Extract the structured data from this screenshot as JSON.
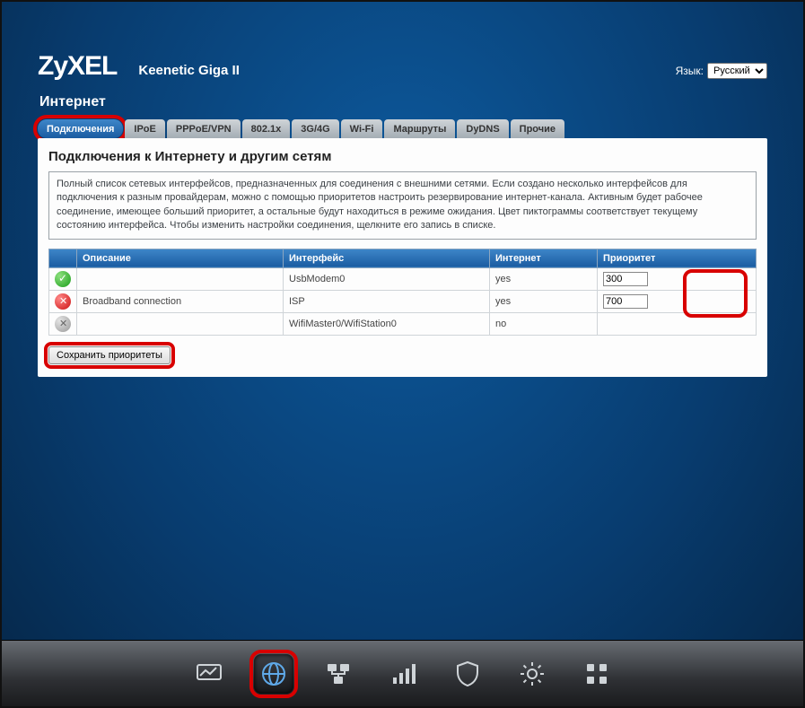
{
  "header": {
    "logo": "ZyXEL",
    "model": "Keenetic Giga II",
    "lang_label": "Язык:",
    "lang_value": "Русский"
  },
  "page_title": "Интернет",
  "tabs": [
    {
      "label": "Подключения",
      "active": true
    },
    {
      "label": "IPoE"
    },
    {
      "label": "PPPoE/VPN"
    },
    {
      "label": "802.1x"
    },
    {
      "label": "3G/4G"
    },
    {
      "label": "Wi-Fi"
    },
    {
      "label": "Маршруты"
    },
    {
      "label": "DyDNS"
    },
    {
      "label": "Прочие"
    }
  ],
  "content": {
    "heading": "Подключения к Интернету и другим сетям",
    "description": "Полный список сетевых интерфейсов, предназначенных для соединения с внешними сетями. Если создано несколько интерфейсов для подключения к разным провайдерам, можно с помощью приоритетов настроить резервирование интернет-канала. Активным будет рабочее соединение, имеющее больший приоритет, а остальные будут находиться в режиме ожидания. Цвет пиктограммы соответствует текущему состоянию интерфейса. Чтобы изменить настройки соединения, щелкните его запись в списке.",
    "columns": {
      "status": "",
      "desc": "Описание",
      "iface": "Интерфейс",
      "inet": "Интернет",
      "prio": "Приоритет"
    },
    "rows": [
      {
        "status": "ok",
        "desc": "",
        "iface": "UsbModem0",
        "inet": "yes",
        "prio": "300"
      },
      {
        "status": "err",
        "desc": "Broadband connection",
        "iface": "ISP",
        "inet": "yes",
        "prio": "700"
      },
      {
        "status": "off",
        "desc": "",
        "iface": "WifiMaster0/WifiStation0",
        "inet": "no",
        "prio": ""
      }
    ],
    "save_label": "Сохранить приоритеты"
  },
  "bottomnav": [
    {
      "name": "monitor-icon"
    },
    {
      "name": "globe-icon",
      "active": true
    },
    {
      "name": "network-icon"
    },
    {
      "name": "signal-icon"
    },
    {
      "name": "shield-icon"
    },
    {
      "name": "gear-icon"
    },
    {
      "name": "apps-icon"
    }
  ]
}
